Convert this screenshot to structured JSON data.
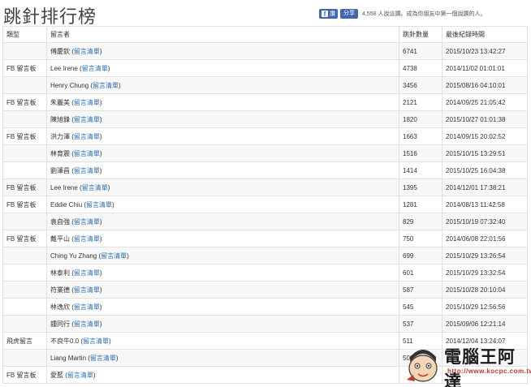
{
  "page": {
    "title": "跳針排行榜"
  },
  "facebook": {
    "like_label": "讚",
    "share_label": "分享",
    "social_text": "4,558 人說這讚。成為你朋友中第一個說讚的人。"
  },
  "table": {
    "headers": {
      "type": "類型",
      "commenter": "留言者",
      "count": "跳針數量",
      "last_time": "最後紀錄時間"
    },
    "link_label": "留言清單",
    "rows": [
      {
        "type": "",
        "name": "傅慶欽",
        "count": "6741",
        "time": "2015/10/23 13:42:27"
      },
      {
        "type": "FB 留言板",
        "name": "Lee Irene",
        "count": "4738",
        "time": "2014/11/02 01:01:01"
      },
      {
        "type": "",
        "name": "Henry Chung",
        "count": "3456",
        "time": "2015/08/16 04:10:01"
      },
      {
        "type": "FB 留言板",
        "name": "朱麗美",
        "count": "2121",
        "time": "2014/09/25 21:05:42"
      },
      {
        "type": "",
        "name": "陳旭鋒",
        "count": "1820",
        "time": "2015/10/27 01:01:38"
      },
      {
        "type": "FB 留言板",
        "name": "洪力澤",
        "count": "1663",
        "time": "2014/09/15 20:02:52"
      },
      {
        "type": "",
        "name": "林育震",
        "count": "1516",
        "time": "2015/10/15 13:29:51"
      },
      {
        "type": "",
        "name": "劉澤昌",
        "count": "1414",
        "time": "2015/10/25 16:04:38"
      },
      {
        "type": "FB 留言板",
        "name": "Lee Irene",
        "count": "1395",
        "time": "2014/12/01 17:38:21"
      },
      {
        "type": "FB 留言板",
        "name": "Eddie Chiu",
        "count": "1281",
        "time": "2014/08/13 11:42:58"
      },
      {
        "type": "",
        "name": "袁自強",
        "count": "829",
        "time": "2015/10/19 07:32:40"
      },
      {
        "type": "FB 留言板",
        "name": "戴平山",
        "count": "750",
        "time": "2014/06/08 22:01:56"
      },
      {
        "type": "",
        "name": "Ching Yu Zhang",
        "count": "699",
        "time": "2015/10/29 13:26:54"
      },
      {
        "type": "",
        "name": "林泰利",
        "count": "601",
        "time": "2015/10/29 13:32:54"
      },
      {
        "type": "",
        "name": "符業德",
        "count": "587",
        "time": "2015/10/28 20:10:04"
      },
      {
        "type": "",
        "name": "林逸欣",
        "count": "545",
        "time": "2015/10/29 12:56:56"
      },
      {
        "type": "",
        "name": "鍾同行",
        "count": "537",
        "time": "2015/09/06 12:21:14"
      },
      {
        "type": "飛虎留言",
        "name": "不良牛0.0",
        "count": "511",
        "time": "2014/12/04 13:24:07"
      },
      {
        "type": "",
        "name": "Liang Martin",
        "count": "500",
        "time": ""
      },
      {
        "type": "FB 留言板",
        "name": "愛藍",
        "count": "",
        "time": ""
      }
    ]
  },
  "watermark": {
    "brand": "電腦王阿達",
    "url": "http://www.kocpc.com.tw"
  }
}
